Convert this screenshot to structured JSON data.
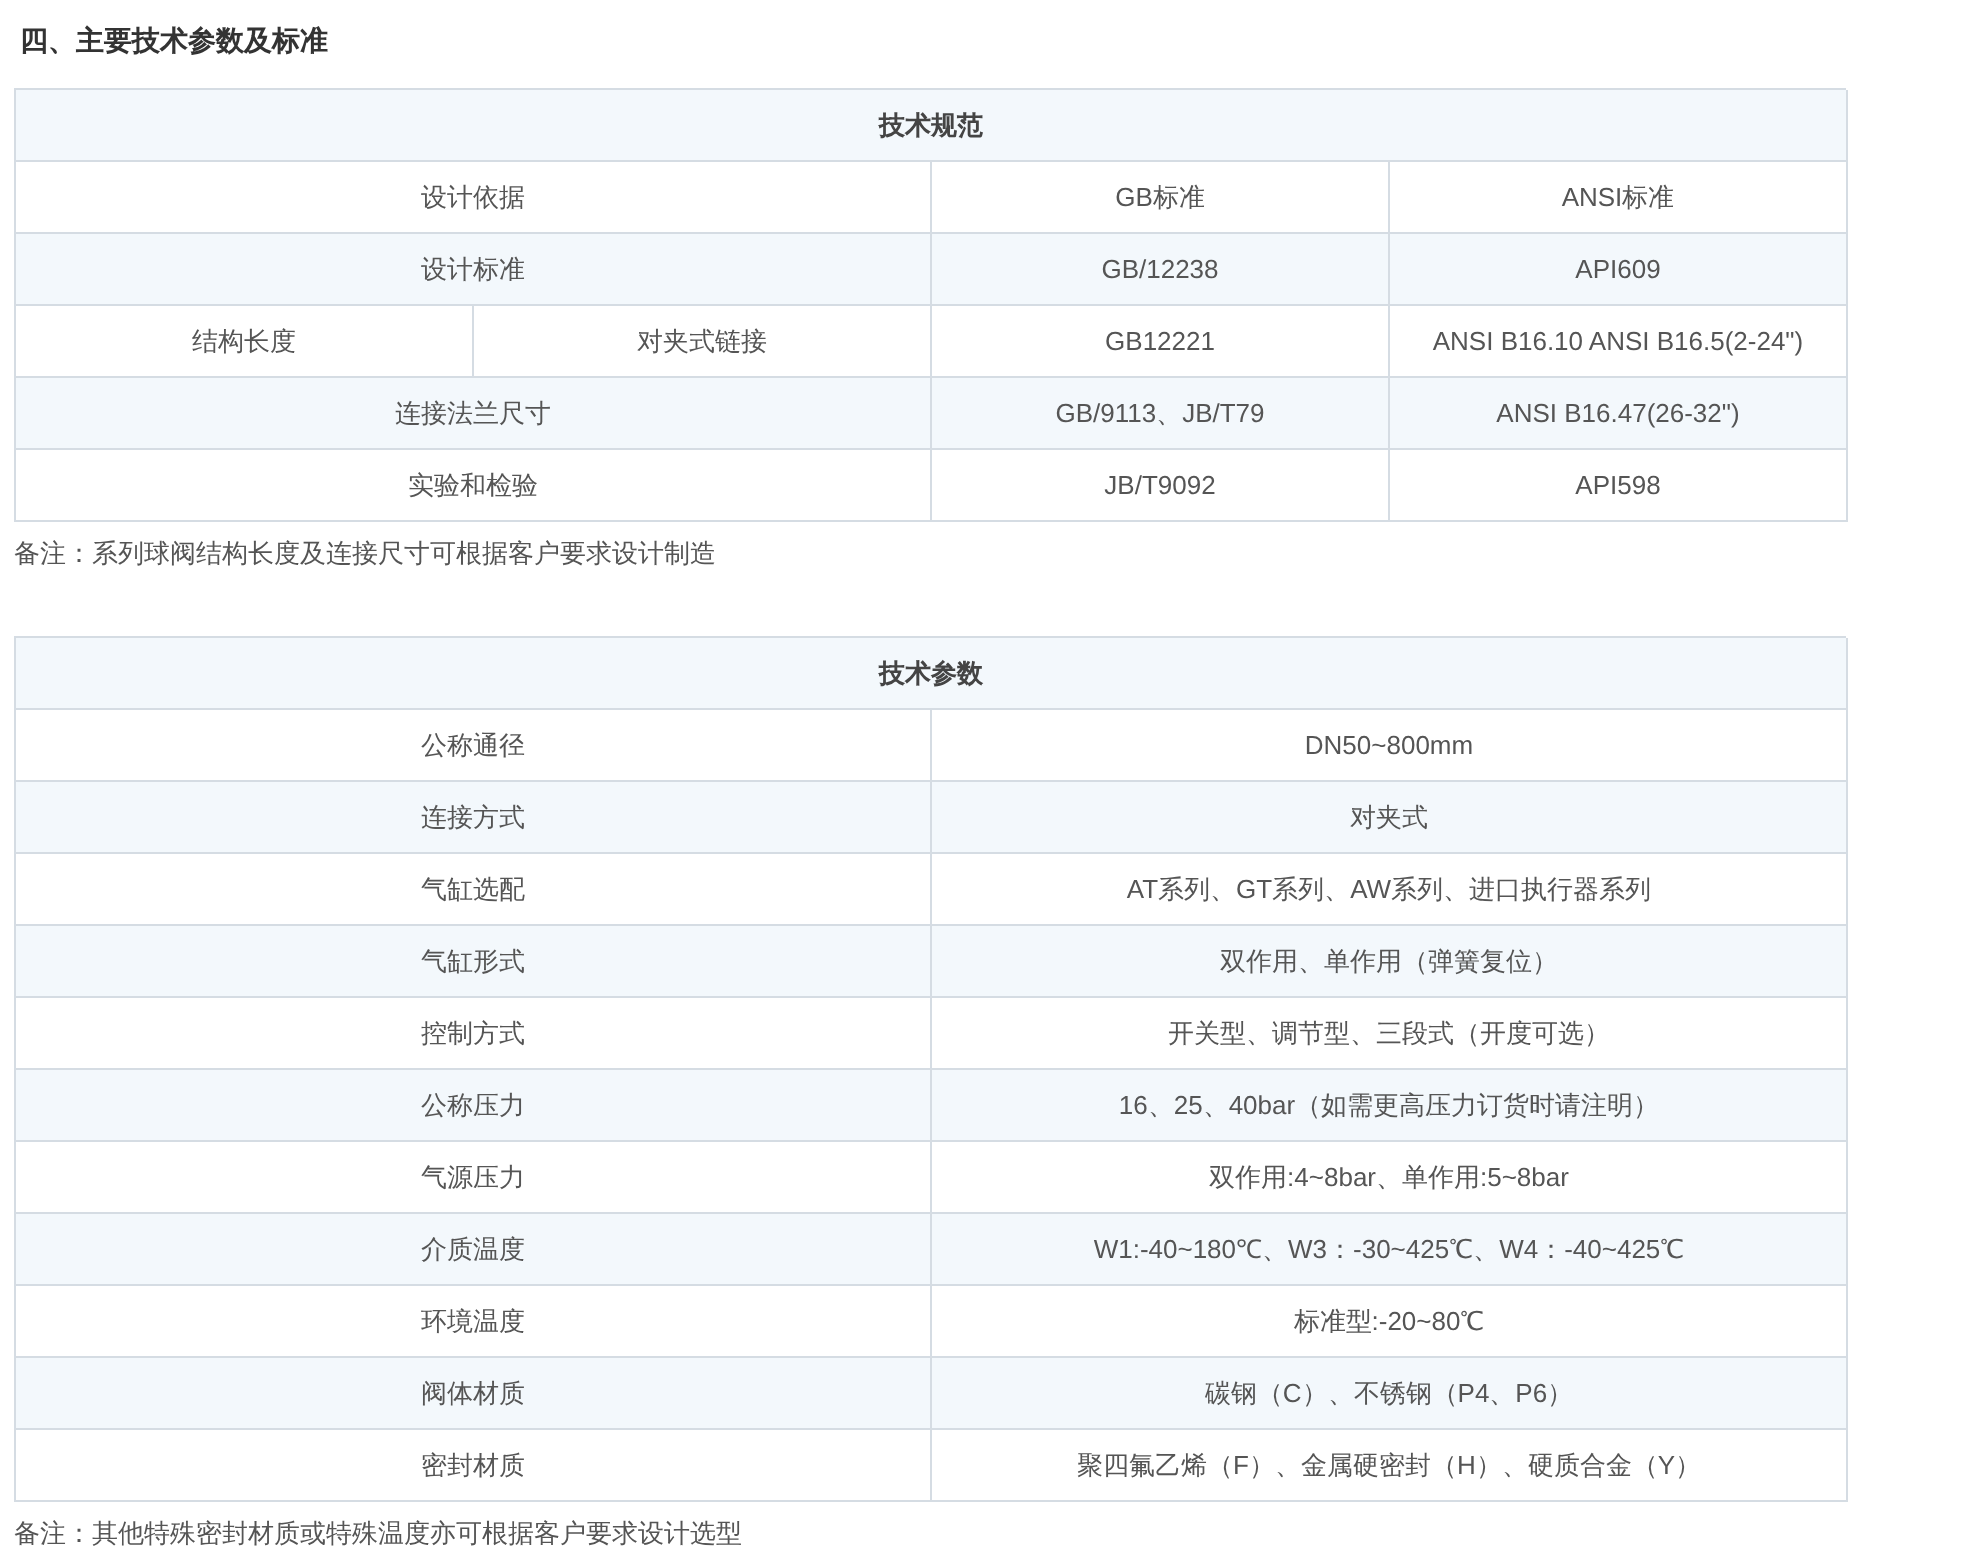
{
  "heading": "四、主要技术参数及标准",
  "spec_table": {
    "title": "技术规范",
    "rows": [
      {
        "label": "设计依据",
        "gb": "GB标准",
        "ansi": "ANSI标准"
      },
      {
        "label": "设计标准",
        "gb": "GB/12238",
        "ansi": "API609"
      },
      {
        "label": "结构长度",
        "sublabel": "对夹式链接",
        "gb": "GB12221",
        "ansi": "ANSI B16.10 ANSI B16.5(2-24\")"
      },
      {
        "label": "连接法兰尺寸",
        "gb": "GB/9113、JB/T79",
        "ansi": "ANSI B16.47(26-32\")"
      },
      {
        "label": "实验和检验",
        "gb": "JB/T9092",
        "ansi": "API598"
      }
    ],
    "note": "备注：系列球阀结构长度及连接尺寸可根据客户要求设计制造"
  },
  "param_table": {
    "title": "技术参数",
    "rows": [
      {
        "label": "公称通径",
        "value": "DN50~800mm"
      },
      {
        "label": "连接方式",
        "value": "对夹式"
      },
      {
        "label": "气缸选配",
        "value": "AT系列、GT系列、AW系列、进口执行器系列"
      },
      {
        "label": "气缸形式",
        "value": "双作用、单作用（弹簧复位）"
      },
      {
        "label": "控制方式",
        "value": "开关型、调节型、三段式（开度可选）"
      },
      {
        "label": "公称压力",
        "value": "16、25、40bar（如需更高压力订货时请注明）"
      },
      {
        "label": "气源压力",
        "value": "双作用:4~8bar、单作用:5~8bar"
      },
      {
        "label": "介质温度",
        "value": "W1:-40~180℃、W3：-30~425℃、W4：-40~425℃"
      },
      {
        "label": "环境温度",
        "value": "标准型:-20~80℃"
      },
      {
        "label": "阀体材质",
        "value": "碳钢（C）、不锈钢（P4、P6）"
      },
      {
        "label": "密封材质",
        "value": "聚四氟乙烯（F）、金属硬密封（H）、硬质合金（Y）"
      }
    ],
    "note": "备注：其他特殊密封材质或特殊温度亦可根据客户要求设计选型"
  }
}
